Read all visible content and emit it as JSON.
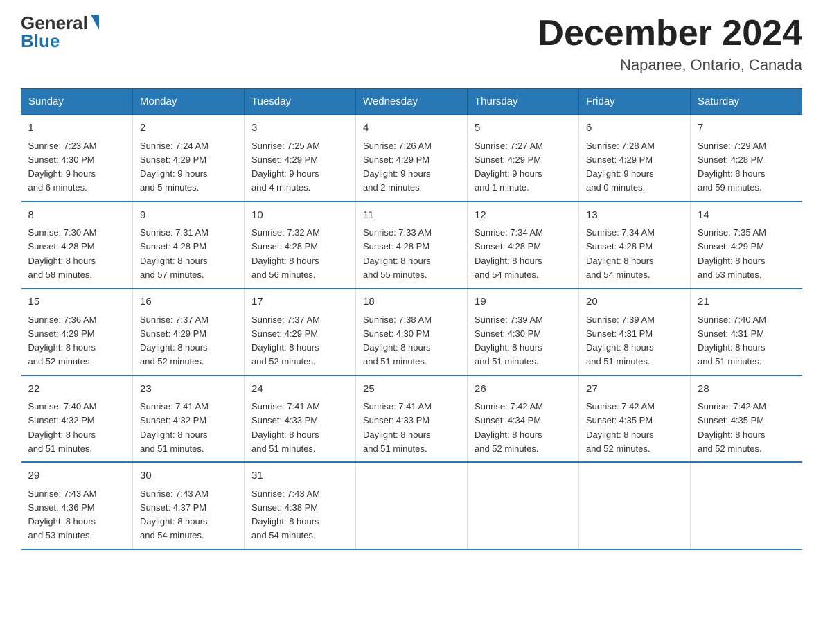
{
  "logo": {
    "text_general": "General",
    "text_blue": "Blue",
    "triangle_color": "#1a6fad"
  },
  "title": {
    "month_year": "December 2024",
    "location": "Napanee, Ontario, Canada"
  },
  "days_of_week": [
    "Sunday",
    "Monday",
    "Tuesday",
    "Wednesday",
    "Thursday",
    "Friday",
    "Saturday"
  ],
  "weeks": [
    [
      {
        "day": "1",
        "sunrise": "7:23 AM",
        "sunset": "4:30 PM",
        "daylight": "9 hours and 6 minutes."
      },
      {
        "day": "2",
        "sunrise": "7:24 AM",
        "sunset": "4:29 PM",
        "daylight": "9 hours and 5 minutes."
      },
      {
        "day": "3",
        "sunrise": "7:25 AM",
        "sunset": "4:29 PM",
        "daylight": "9 hours and 4 minutes."
      },
      {
        "day": "4",
        "sunrise": "7:26 AM",
        "sunset": "4:29 PM",
        "daylight": "9 hours and 2 minutes."
      },
      {
        "day": "5",
        "sunrise": "7:27 AM",
        "sunset": "4:29 PM",
        "daylight": "9 hours and 1 minute."
      },
      {
        "day": "6",
        "sunrise": "7:28 AM",
        "sunset": "4:29 PM",
        "daylight": "9 hours and 0 minutes."
      },
      {
        "day": "7",
        "sunrise": "7:29 AM",
        "sunset": "4:28 PM",
        "daylight": "8 hours and 59 minutes."
      }
    ],
    [
      {
        "day": "8",
        "sunrise": "7:30 AM",
        "sunset": "4:28 PM",
        "daylight": "8 hours and 58 minutes."
      },
      {
        "day": "9",
        "sunrise": "7:31 AM",
        "sunset": "4:28 PM",
        "daylight": "8 hours and 57 minutes."
      },
      {
        "day": "10",
        "sunrise": "7:32 AM",
        "sunset": "4:28 PM",
        "daylight": "8 hours and 56 minutes."
      },
      {
        "day": "11",
        "sunrise": "7:33 AM",
        "sunset": "4:28 PM",
        "daylight": "8 hours and 55 minutes."
      },
      {
        "day": "12",
        "sunrise": "7:34 AM",
        "sunset": "4:28 PM",
        "daylight": "8 hours and 54 minutes."
      },
      {
        "day": "13",
        "sunrise": "7:34 AM",
        "sunset": "4:28 PM",
        "daylight": "8 hours and 54 minutes."
      },
      {
        "day": "14",
        "sunrise": "7:35 AM",
        "sunset": "4:29 PM",
        "daylight": "8 hours and 53 minutes."
      }
    ],
    [
      {
        "day": "15",
        "sunrise": "7:36 AM",
        "sunset": "4:29 PM",
        "daylight": "8 hours and 52 minutes."
      },
      {
        "day": "16",
        "sunrise": "7:37 AM",
        "sunset": "4:29 PM",
        "daylight": "8 hours and 52 minutes."
      },
      {
        "day": "17",
        "sunrise": "7:37 AM",
        "sunset": "4:29 PM",
        "daylight": "8 hours and 52 minutes."
      },
      {
        "day": "18",
        "sunrise": "7:38 AM",
        "sunset": "4:30 PM",
        "daylight": "8 hours and 51 minutes."
      },
      {
        "day": "19",
        "sunrise": "7:39 AM",
        "sunset": "4:30 PM",
        "daylight": "8 hours and 51 minutes."
      },
      {
        "day": "20",
        "sunrise": "7:39 AM",
        "sunset": "4:31 PM",
        "daylight": "8 hours and 51 minutes."
      },
      {
        "day": "21",
        "sunrise": "7:40 AM",
        "sunset": "4:31 PM",
        "daylight": "8 hours and 51 minutes."
      }
    ],
    [
      {
        "day": "22",
        "sunrise": "7:40 AM",
        "sunset": "4:32 PM",
        "daylight": "8 hours and 51 minutes."
      },
      {
        "day": "23",
        "sunrise": "7:41 AM",
        "sunset": "4:32 PM",
        "daylight": "8 hours and 51 minutes."
      },
      {
        "day": "24",
        "sunrise": "7:41 AM",
        "sunset": "4:33 PM",
        "daylight": "8 hours and 51 minutes."
      },
      {
        "day": "25",
        "sunrise": "7:41 AM",
        "sunset": "4:33 PM",
        "daylight": "8 hours and 51 minutes."
      },
      {
        "day": "26",
        "sunrise": "7:42 AM",
        "sunset": "4:34 PM",
        "daylight": "8 hours and 52 minutes."
      },
      {
        "day": "27",
        "sunrise": "7:42 AM",
        "sunset": "4:35 PM",
        "daylight": "8 hours and 52 minutes."
      },
      {
        "day": "28",
        "sunrise": "7:42 AM",
        "sunset": "4:35 PM",
        "daylight": "8 hours and 52 minutes."
      }
    ],
    [
      {
        "day": "29",
        "sunrise": "7:43 AM",
        "sunset": "4:36 PM",
        "daylight": "8 hours and 53 minutes."
      },
      {
        "day": "30",
        "sunrise": "7:43 AM",
        "sunset": "4:37 PM",
        "daylight": "8 hours and 54 minutes."
      },
      {
        "day": "31",
        "sunrise": "7:43 AM",
        "sunset": "4:38 PM",
        "daylight": "8 hours and 54 minutes."
      },
      null,
      null,
      null,
      null
    ]
  ],
  "labels": {
    "sunrise": "Sunrise:",
    "sunset": "Sunset:",
    "daylight": "Daylight:"
  }
}
